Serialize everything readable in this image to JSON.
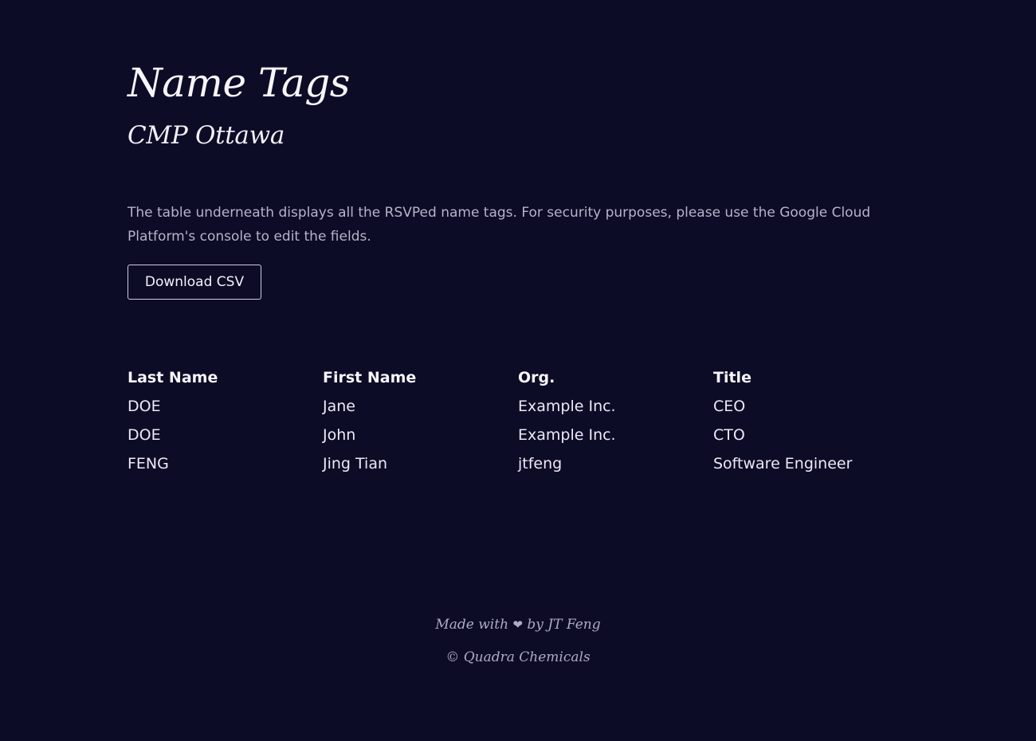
{
  "header": {
    "title": "Name Tags",
    "subtitle": "CMP Ottawa"
  },
  "intro": {
    "description": "The table underneath displays all the RSVPed name tags. For security purposes, please use the Google Cloud Platform's console to edit the fields."
  },
  "actions": {
    "download_label": "Download CSV"
  },
  "table": {
    "columns": [
      "Last Name",
      "First Name",
      "Org.",
      "Title"
    ],
    "rows": [
      [
        "DOE",
        "Jane",
        "Example Inc.",
        "CEO"
      ],
      [
        "DOE",
        "John",
        "Example Inc.",
        "CTO"
      ],
      [
        "FENG",
        "Jing Tian",
        "jtfeng",
        "Software Engineer"
      ]
    ]
  },
  "footer": {
    "made_with_prefix": "Made with",
    "heart_glyph": "❤",
    "made_with_suffix": "by JT Feng",
    "copyright": "© Quadra Chemicals"
  },
  "colors": {
    "background": "#0d0c26",
    "text": "#f4f2fb",
    "muted_text": "#b6b3c9"
  }
}
